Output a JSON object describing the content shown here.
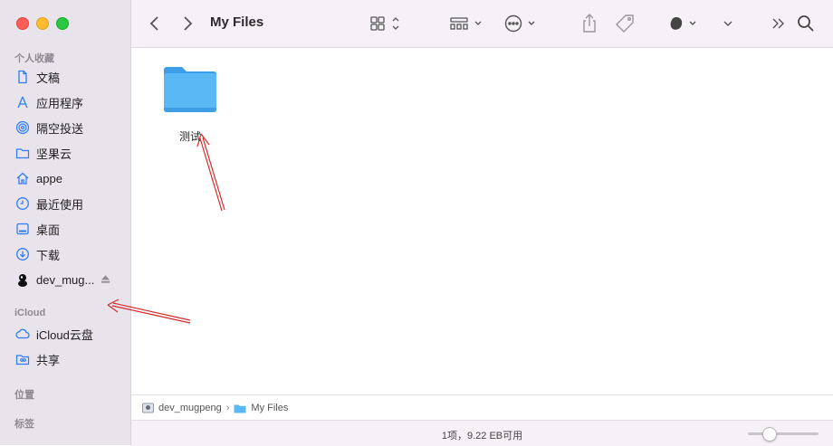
{
  "window": {
    "title": "My Files"
  },
  "sidebar": {
    "favorites_title": "个人收藏",
    "favorites": [
      {
        "label": "文稿",
        "icon": "document-icon"
      },
      {
        "label": "应用程序",
        "icon": "applications-icon"
      },
      {
        "label": "隔空投送",
        "icon": "airdrop-icon"
      },
      {
        "label": "坚果云",
        "icon": "folder-icon"
      },
      {
        "label": "appe",
        "icon": "home-icon"
      },
      {
        "label": "最近使用",
        "icon": "clock-icon"
      },
      {
        "label": "桌面",
        "icon": "desktop-icon"
      },
      {
        "label": "下载",
        "icon": "download-icon"
      },
      {
        "label": "dev_mug...",
        "icon": "avatar-icon"
      }
    ],
    "icloud_title": "iCloud",
    "icloud": [
      {
        "label": "iCloud云盘",
        "icon": "cloud-icon"
      },
      {
        "label": "共享",
        "icon": "shared-folder-icon"
      }
    ],
    "locations_title": "位置",
    "tags_title": "标签"
  },
  "content": {
    "items": [
      {
        "label": "测试",
        "icon": "folder-icon"
      }
    ]
  },
  "pathbar": {
    "crumbs": [
      "dev_mugpeng",
      "My Files"
    ]
  },
  "status": {
    "text": "1项，9.22 EB可用",
    "zoom_level": 0.25
  },
  "colors": {
    "accent": "#2f7cf6",
    "annotation": "#d62a2a",
    "folder": "#5ab8f5"
  }
}
